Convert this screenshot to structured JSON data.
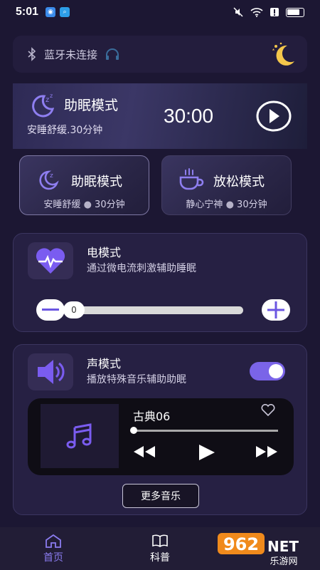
{
  "status_bar": {
    "time": "5:01",
    "battery_label": ""
  },
  "bluetooth": {
    "status_text": "蓝牙未连接"
  },
  "hero": {
    "title": "助眠模式",
    "subtitle": "安睡舒缓.30分钟",
    "timer": "30:00"
  },
  "modes": [
    {
      "title": "助眠模式",
      "desc": "安睡舒缓",
      "duration": "30分钟"
    },
    {
      "title": "放松模式",
      "desc": "静心宁神",
      "duration": "30分钟"
    }
  ],
  "electric": {
    "title": "电模式",
    "desc": "通过微电流刺激辅助睡眠",
    "level": "0"
  },
  "sound": {
    "title": "声模式",
    "desc": "播放特殊音乐辅助助眠",
    "enabled": true,
    "track": "古典06",
    "more_label": "更多音乐"
  },
  "tabs": [
    {
      "label": "首页",
      "icon": "home-icon",
      "active": true
    },
    {
      "label": "科普",
      "icon": "book-icon",
      "active": false
    },
    {
      "label": "",
      "icon": "",
      "active": false
    }
  ],
  "watermark": {
    "text": "962",
    "suffix": "NET",
    "sub": "乐游网"
  },
  "colors": {
    "accent": "#8b7cf0",
    "toggle": "#7a64e8",
    "bg": "#1c1733"
  }
}
